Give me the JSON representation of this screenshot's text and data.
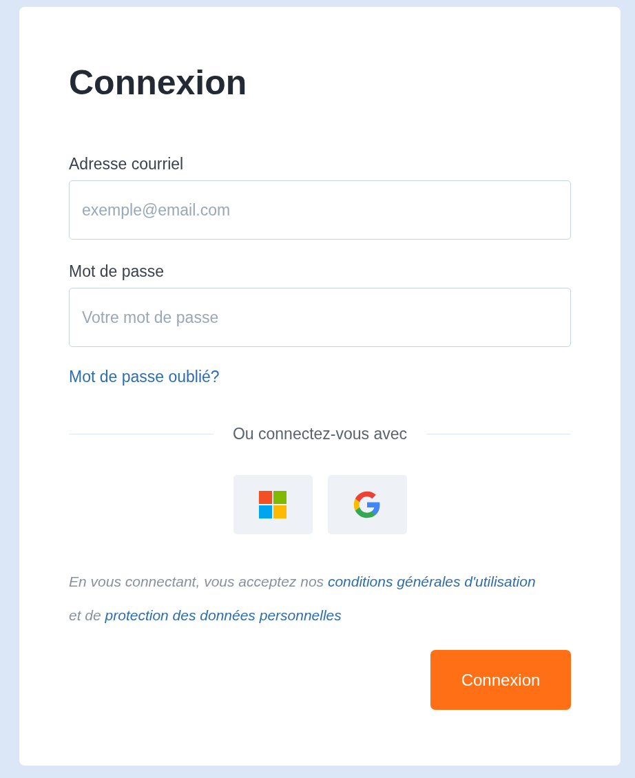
{
  "title": "Connexion",
  "fields": [
    {
      "label": "Adresse courriel",
      "placeholder": "exemple@email.com"
    },
    {
      "label": "Mot de passe",
      "placeholder": "Votre mot de passe"
    }
  ],
  "forgot_link": "Mot de passe oublié?",
  "divider_text": "Ou connectez-vous avec",
  "social_buttons": [
    {
      "kind": "microsoft"
    },
    {
      "kind": "google"
    }
  ],
  "terms": [
    {
      "kind": "text",
      "text": "En vous connectant, vous acceptez nos "
    },
    {
      "kind": "link",
      "text": "conditions générales d'utilisation"
    },
    {
      "kind": "text",
      "text": " et de "
    },
    {
      "kind": "link",
      "text": "protection des données personnelles"
    }
  ],
  "submit": "Connexion"
}
